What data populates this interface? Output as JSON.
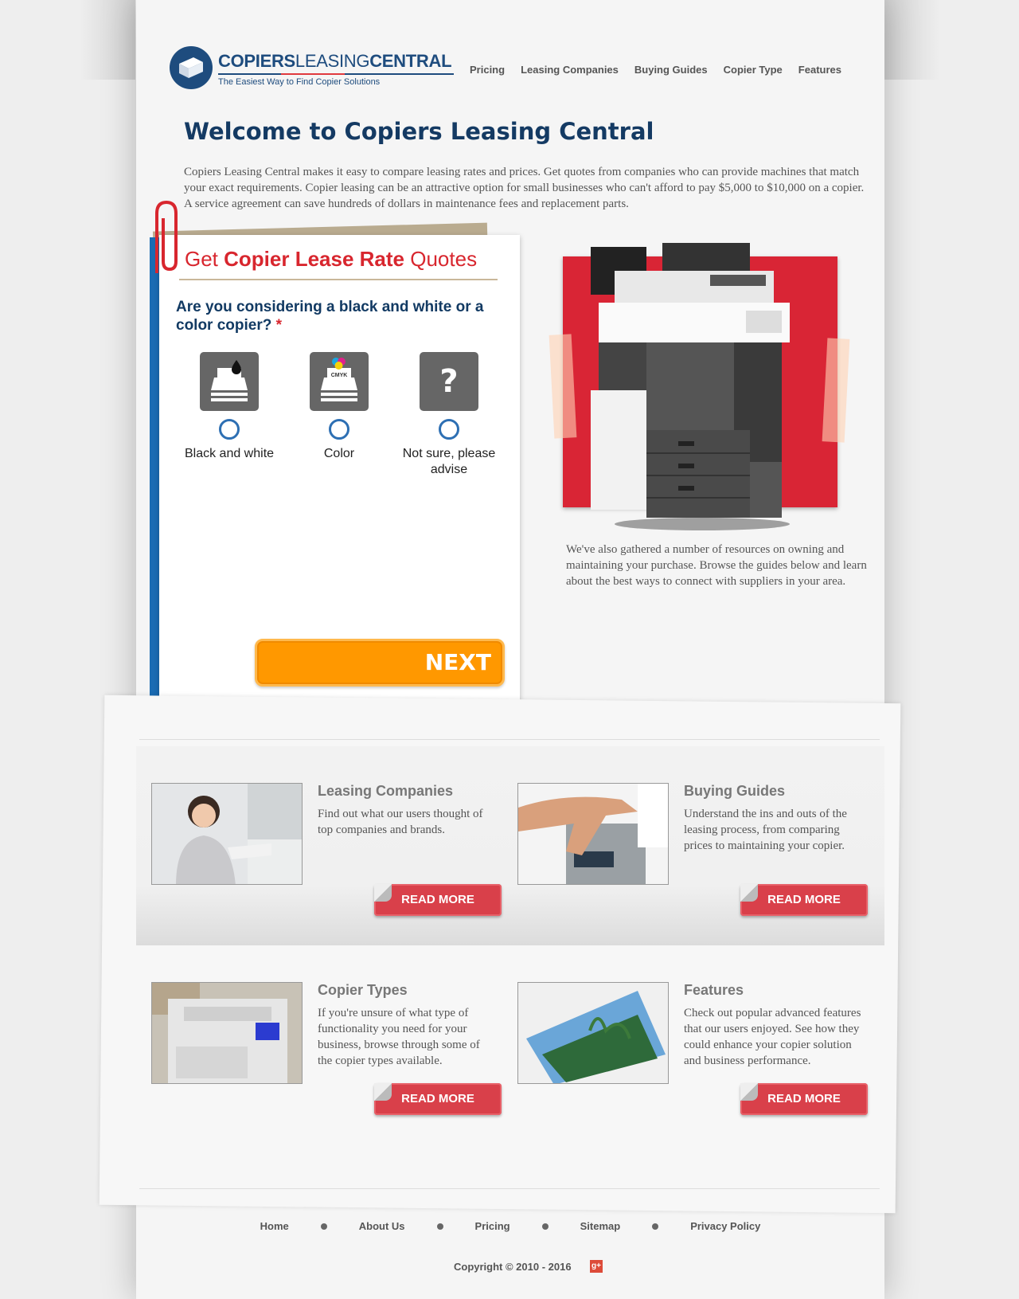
{
  "header": {
    "logo_main": "COPIERS",
    "logo_mid": "LEASING",
    "logo_end": "CENTRAL",
    "logo_tagline": "The Easiest Way to Find Copier Solutions",
    "nav": [
      "Pricing",
      "Leasing Companies",
      "Buying Guides",
      "Copier Type",
      "Features"
    ]
  },
  "main": {
    "title": "Welcome to Copiers Leasing Central",
    "intro": "Copiers Leasing Central makes it easy to compare leasing rates and prices. Get quotes from companies who can provide machines that match your exact requirements. Copier leasing can be an attractive option for small businesses who can't afford to pay $5,000 to $10,000 on a copier. A service agreement can save hundreds of dollars in maintenance fees and replacement parts.",
    "resources": "We've also gathered a number of resources on owning and maintaining your purchase. Browse the guides below and learn about the best ways to connect with suppliers in your area."
  },
  "form": {
    "title_pre": "Get ",
    "title_bold": "Copier Lease Rate",
    "title_post": " Quotes",
    "question": "Are you considering a black and white or a color copier?",
    "required_mark": "*",
    "options": [
      {
        "label": "Black and white",
        "icon": "bw-paper-icon"
      },
      {
        "label": "Color",
        "icon": "cmyk-paper-icon",
        "icon_text": "CMYK"
      },
      {
        "label": "Not sure, please advise",
        "icon": "question-icon",
        "icon_text": "?"
      }
    ],
    "next_label": "NEXT"
  },
  "features": [
    {
      "title": "Leasing Companies",
      "text": "Find out what our users thought of top companies and brands.",
      "button": "READ MORE"
    },
    {
      "title": "Buying Guides",
      "text": "Understand the ins and outs of the leasing process, from comparing prices to maintaining your copier.",
      "button": "READ MORE"
    },
    {
      "title": "Copier Types",
      "text": "If you're unsure of what type of functionality you need for your business, browse through some of the copier types available.",
      "button": "READ MORE"
    },
    {
      "title": "Features",
      "text": "Check out popular advanced features that our users enjoyed. See how they could enhance your copier solution and business performance.",
      "button": "READ MORE"
    }
  ],
  "footer": {
    "links": [
      "Home",
      "About Us",
      "Pricing",
      "Sitemap",
      "Privacy Policy"
    ],
    "copyright": "Copyright © 2010 - 2016",
    "gplus": "g+"
  },
  "colors": {
    "brand_blue": "#1e4c7e",
    "accent_red": "#d8262e",
    "next_orange": "#ff9800",
    "read_more_red": "#d9404a"
  }
}
